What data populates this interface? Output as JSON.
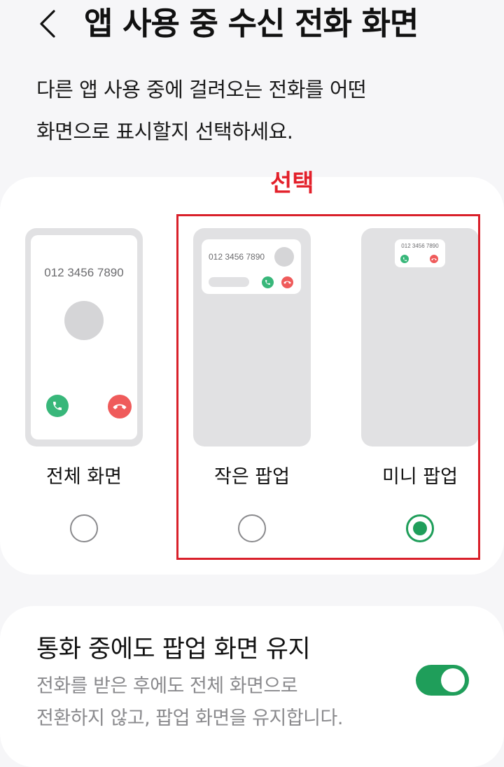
{
  "header": {
    "title": "앱 사용 중 수신 전화 화면",
    "back_icon": "chevron-left-icon"
  },
  "description": {
    "line1": "다른 앱 사용 중에 걸려오는 전화를 어떤",
    "line2": "화면으로 표시할지 선택하세요."
  },
  "annotation": {
    "label": "선택",
    "color": "#e3202a"
  },
  "options": [
    {
      "label": "전체 화면",
      "phone_number": "012 3456 7890",
      "selected": false
    },
    {
      "label": "작은 팝업",
      "phone_number": "012 3456 7890",
      "selected": false
    },
    {
      "label": "미니 팝업",
      "phone_number": "012 3456 7890",
      "selected": true
    }
  ],
  "keep_popup": {
    "title": "통화 중에도 팝업 화면 유지",
    "subtitle_line1": "전화를 받은 후에도 전체 화면으로",
    "subtitle_line2": "전환하지 않고, 팝업 화면을 유지합니다.",
    "enabled": true
  },
  "colors": {
    "accent": "#1f9e5a",
    "accept_call": "#38b77a",
    "decline_call": "#ef5b5b",
    "background": "#f6f6f8"
  }
}
